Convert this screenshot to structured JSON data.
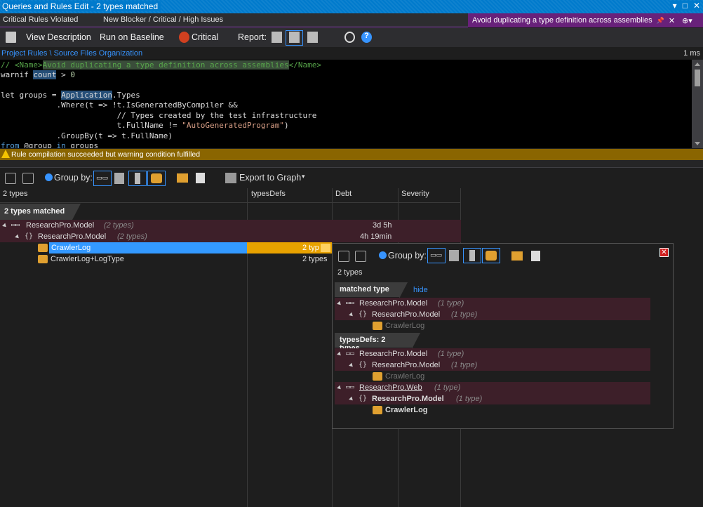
{
  "window": {
    "title": "Queries and Rules Edit  - 2 types matched",
    "controls": [
      "▾",
      "□",
      "✕"
    ]
  },
  "tabs": {
    "items": [
      "Critical Rules Violated",
      "New Blocker / Critical / High Issues"
    ],
    "active": "Avoid duplicating a type definition across assemblies",
    "active_pin": "📌",
    "active_close": "✕"
  },
  "toolbar": {
    "view_description": "View Description",
    "run_on_baseline": "Run on Baseline",
    "critical": "Critical",
    "report": "Report:"
  },
  "breadcrumb": {
    "path": "Project Rules \\ Source Files Organization",
    "time": "1 ms"
  },
  "editor": {
    "l1_a": "// <Name>",
    "l1_b": "Avoid duplicating a type definition across assemblies",
    "l1_c": "</Name>",
    "l2_a": "warnif ",
    "l2_b": "count",
    "l2_c": " > ",
    "l2_d": "0",
    "l4_a": "let groups = ",
    "l4_b": "Application",
    "l4_c": ".Types",
    "l5": "            .Where(t => !t.IsGeneratedByCompiler &&",
    "l6": "                         // Types created by the test infrastructure",
    "l7_a": "                         t.FullName != ",
    "l7_b": "\"AutoGeneratedProgram\"",
    "l7_c": ")",
    "l8": "            .GroupBy(t => t.FullName)",
    "l9_a": "from ",
    "l9_b": "@group",
    "l9_c": " in ",
    "l9_d": "groups"
  },
  "warning": "Rule compilation succeeded but warning condition fulfilled",
  "results_toolbar": {
    "group_by": "Group by:",
    "export": "Export to Graph"
  },
  "grid": {
    "headers": [
      "2 types",
      "typesDefs",
      "Debt",
      "Severity"
    ],
    "group_tab": "2 types matched",
    "rows": [
      {
        "name": "ResearchPro.Model",
        "count": "(2 types)",
        "debt": "3d  5h"
      },
      {
        "name": "ResearchPro.Model",
        "count": "(2 types)",
        "debt": "4h  19min"
      },
      {
        "name": "CrawlerLog",
        "typesdefs": "2 typ"
      },
      {
        "name": "CrawlerLog+LogType",
        "typesdefs": "2 types"
      }
    ]
  },
  "popup": {
    "group_by": "Group by:",
    "count": "2 types",
    "section1": "matched type",
    "hide": "hide",
    "s1_rows": [
      {
        "name": "ResearchPro.Model",
        "count": "(1 type)"
      },
      {
        "name": "ResearchPro.Model",
        "count": "(1 type)"
      },
      {
        "name": "CrawlerLog"
      }
    ],
    "section2": "typesDefs:  2 types",
    "s2_rows": [
      {
        "name": "ResearchPro.Model",
        "count": "(1 type)"
      },
      {
        "name": "ResearchPro.Model",
        "count": "(1 type)"
      },
      {
        "name": "CrawlerLog"
      },
      {
        "name": "ResearchPro.Web",
        "count": "(1 type)"
      },
      {
        "name": "ResearchPro.Model",
        "count": "(1 type)"
      },
      {
        "name": "CrawlerLog"
      }
    ]
  }
}
